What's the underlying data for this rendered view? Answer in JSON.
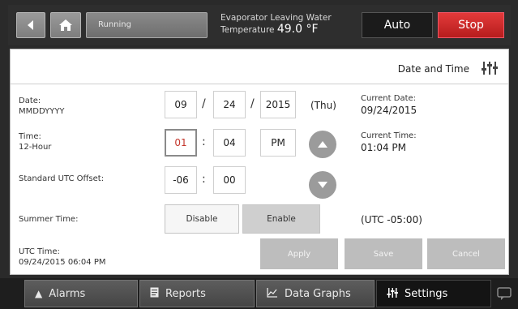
{
  "header": {
    "status": "Running",
    "evap_label_line1": "Evaporator Leaving Water",
    "evap_label_line2": "Temperature",
    "evap_value": "49.0 °F",
    "auto_label": "Auto",
    "stop_label": "Stop",
    "icons": {
      "back": "back-arrow-icon",
      "home": "home-icon"
    }
  },
  "panel": {
    "title": "Date and Time",
    "title_icon": "settings-sliders-icon"
  },
  "date": {
    "label": "Date:",
    "format": "MMDDYYYY",
    "month": "09",
    "day": "24",
    "year": "2015",
    "separator": "/",
    "day_of_week": "(Thu)",
    "current_label": "Current Date:",
    "current_value": "09/24/2015"
  },
  "time": {
    "label": "Time:",
    "format": "12-Hour",
    "hour": "01",
    "minute": "04",
    "ampm": "PM",
    "separator": ":",
    "current_label": "Current Time:",
    "current_value": "01:04 PM"
  },
  "utc_offset": {
    "label": "Standard UTC Offset:",
    "hours": "-06",
    "minutes": "00",
    "separator": ":"
  },
  "summer_time": {
    "label": "Summer Time:",
    "disable_label": "Disable",
    "enable_label": "Enable",
    "selected": "Enable",
    "effective_offset": "(UTC -05:00)"
  },
  "utc_time": {
    "label": "UTC Time:",
    "value": "09/24/2015 06:04 PM"
  },
  "actions": {
    "apply": "Apply",
    "save": "Save",
    "cancel": "Cancel"
  },
  "tabs": [
    {
      "label": "Alarms",
      "icon": "bell-icon"
    },
    {
      "label": "Reports",
      "icon": "report-icon"
    },
    {
      "label": "Data Graphs",
      "icon": "graph-icon"
    },
    {
      "label": "Settings",
      "icon": "settings-sliders-icon",
      "active": true
    }
  ],
  "colors": {
    "stop": "#c62828",
    "active_field_text": "#c4362b",
    "panel": "#ffffff",
    "bar": "#2e2e2e"
  }
}
